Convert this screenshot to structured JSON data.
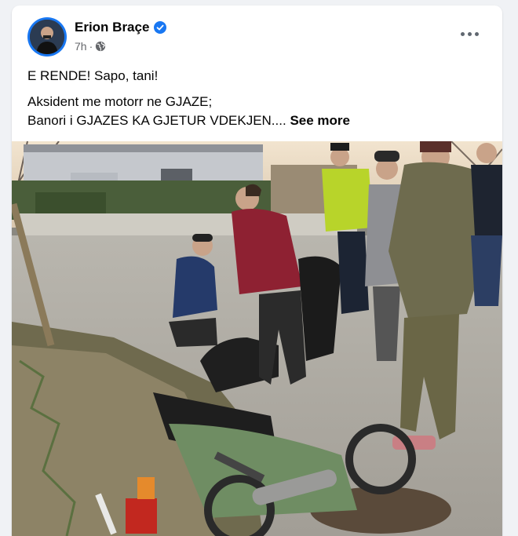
{
  "post": {
    "author": "Erion Braçe",
    "verified": true,
    "time": "7h",
    "separator": "·",
    "audience_icon": "globe-icon",
    "more_icon": "ellipsis-icon",
    "text_line1": "E RENDE! Sapo, tani!",
    "text_line2": "Aksident me motorr ne GJAZE;",
    "text_line3": "Banori i GJAZES KA GJETUR VDEKJEN....",
    "see_more": "See more"
  },
  "colors": {
    "brand_blue": "#1877f2",
    "text_primary": "#050505",
    "text_secondary": "#65676b",
    "page_background": "#f0f2f5"
  }
}
